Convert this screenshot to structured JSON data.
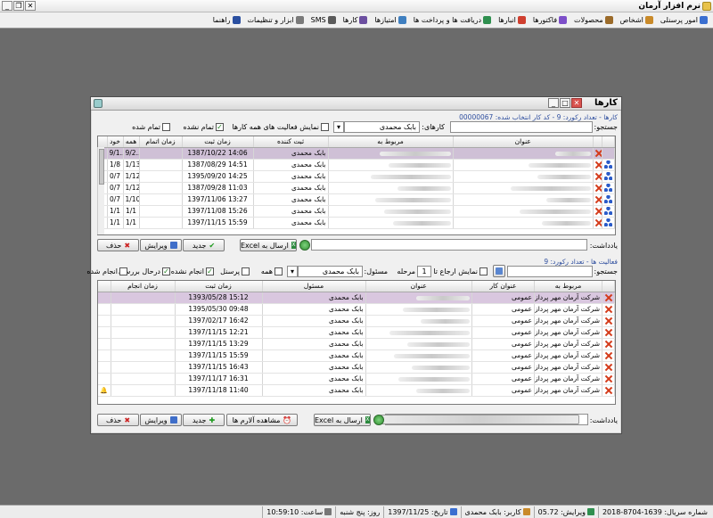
{
  "app": {
    "title": "نرم افزار آرمان"
  },
  "menu": [
    {
      "label": "امور پرسنلی",
      "icon": "people-icon",
      "color": "#3b6fd0"
    },
    {
      "label": "اشخاص",
      "icon": "person-icon",
      "color": "#c98a2a"
    },
    {
      "label": "محصولات",
      "icon": "box-icon",
      "color": "#9b6b2a"
    },
    {
      "label": "فاکتورها",
      "icon": "invoice-icon",
      "color": "#7d4fc9"
    },
    {
      "label": "انبارها",
      "icon": "warehouse-icon",
      "color": "#cf3f2f"
    },
    {
      "label": "دریافت ها و پرداخت ها",
      "icon": "payment-icon",
      "color": "#2f8f4f"
    },
    {
      "label": "امتیازها",
      "icon": "star-icon",
      "color": "#3f7fc0"
    },
    {
      "label": "کارها",
      "icon": "tasks-icon",
      "color": "#6c4fa0"
    },
    {
      "label": "SMS",
      "icon": "sms-icon",
      "color": "#5a5a5a"
    },
    {
      "label": "ابزار و تنظیمات",
      "icon": "tools-icon",
      "color": "#7a7a7a"
    },
    {
      "label": "راهنما",
      "icon": "help-icon",
      "color": "#2a4fa0"
    }
  ],
  "dialog": {
    "title": "کارها",
    "info1": "کارها - تعداد رکورد: 9 - کد کار انتخاب شده: 00000067",
    "search_label": "جستجو:",
    "tasks_label": "کارهای:",
    "tasks_user": "بابک محمدی",
    "chk_all_activity": "نمایش فعالیت های همه کارها",
    "chk_unfinished": "تمام نشده",
    "chk_finished": "تمام شده",
    "tasks_headers": [
      "عنوان",
      "مربوط به",
      "ثبت کننده",
      "زمان ثبت",
      "زمان اتمام",
      "همه",
      "خود"
    ],
    "tasks_rows": [
      {
        "recorder": "بابک محمدی",
        "time": "1387/10/22 14:06",
        "end": "",
        "all": "9/2...",
        "own": "9/1...",
        "sel": true
      },
      {
        "recorder": "بابک محمدی",
        "time": "1387/08/29 14:51",
        "end": "",
        "all": "1/13",
        "own": "1/8",
        "sel": false
      },
      {
        "recorder": "بابک محمدی",
        "time": "1395/09/20 14:25",
        "end": "",
        "all": "1/12",
        "own": "0/7",
        "sel": false
      },
      {
        "recorder": "بابک محمدی",
        "time": "1387/09/28 11:03",
        "end": "",
        "all": "1/12",
        "own": "0/7",
        "sel": false
      },
      {
        "recorder": "بابک محمدی",
        "time": "1397/11/06 13:27",
        "end": "",
        "all": "1/10",
        "own": "0/7",
        "sel": false
      },
      {
        "recorder": "بابک محمدی",
        "time": "1397/11/08 15:26",
        "end": "",
        "all": "1/1",
        "own": "1/1",
        "sel": false
      },
      {
        "recorder": "بابک محمدی",
        "time": "1397/11/15 15:59",
        "end": "",
        "all": "1/1",
        "own": "1/1",
        "sel": false
      }
    ],
    "note_label": "یادداشت:",
    "btn_send_excel": "ارسال به Excel",
    "btn_new": "جدید",
    "btn_edit": "ویرایش",
    "btn_delete": "حذف",
    "info2": "فعالیت ها - تعداد رکورد: 9",
    "act_search_label": "جستجو:",
    "chk_show_refer": "نمایش ارجاع تا",
    "stage_value": "1",
    "stage_label": "مرحله",
    "responsible_label": "مسئول:",
    "responsible_user": "بابک محمدی",
    "chk_all": "همه",
    "chk_personnel": "پرسنل",
    "chk_done": "انجام نشده",
    "chk_review": "درحال بررسی",
    "chk_act_done": "انجام شده",
    "act_headers": [
      "مربوط به",
      "عنوان کار",
      "عنوان",
      "مسئول",
      "زمان ثبت",
      "زمان انجام"
    ],
    "act_rows": [
      {
        "rel": "شرکت آرمان مهر پرداز ...",
        "work": "عمومی",
        "resp": "بابک محمدی",
        "time": "1393/05/28 15:12",
        "done": "",
        "sel": true
      },
      {
        "rel": "شرکت آرمان مهر پرداز ...",
        "work": "عمومی",
        "resp": "بابک محمدی",
        "time": "1395/05/30 09:48",
        "done": "",
        "sel": false
      },
      {
        "rel": "شرکت آرمان مهر پرداز ...",
        "work": "عمومی",
        "resp": "بابک محمدی",
        "time": "1397/02/17 16:42",
        "done": "",
        "sel": false
      },
      {
        "rel": "شرکت آرمان مهر پرداز ...",
        "work": "عمومی",
        "resp": "بابک محمدی",
        "time": "1397/11/15 12:21",
        "done": "",
        "sel": false
      },
      {
        "rel": "شرکت آرمان مهر پرداز ...",
        "work": "عمومی",
        "resp": "بابک محمدی",
        "time": "1397/11/15 13:29",
        "done": "",
        "sel": false
      },
      {
        "rel": "شرکت آرمان مهر پرداز ...",
        "work": "عمومی",
        "resp": "بابک محمدی",
        "time": "1397/11/15 15:59",
        "done": "",
        "sel": false
      },
      {
        "rel": "شرکت آرمان مهر پرداز ...",
        "work": "عمومی",
        "resp": "بابک محمدی",
        "time": "1397/11/15 16:43",
        "done": "",
        "sel": false
      },
      {
        "rel": "شرکت آرمان مهر پرداز ...",
        "work": "عمومی",
        "resp": "بابک محمدی",
        "time": "1397/11/17 16:31",
        "done": "",
        "sel": false
      },
      {
        "rel": "شرکت آرمان مهر پرداز ...",
        "work": "عمومی",
        "resp": "بابک محمدی",
        "time": "1397/11/18 11:40",
        "done": "",
        "sel": false
      }
    ],
    "btn_alarms": "مشاهده آلارم ها"
  },
  "status": {
    "serial": "شماره سریال: 1639-8704-2018",
    "version": "ویرایش: 05.72",
    "user": "کاربر: بابک محمدی",
    "date": "تاریخ: 1397/11/25",
    "day": "روز: پنج شنبه",
    "time": "ساعت: 10:59:10"
  }
}
